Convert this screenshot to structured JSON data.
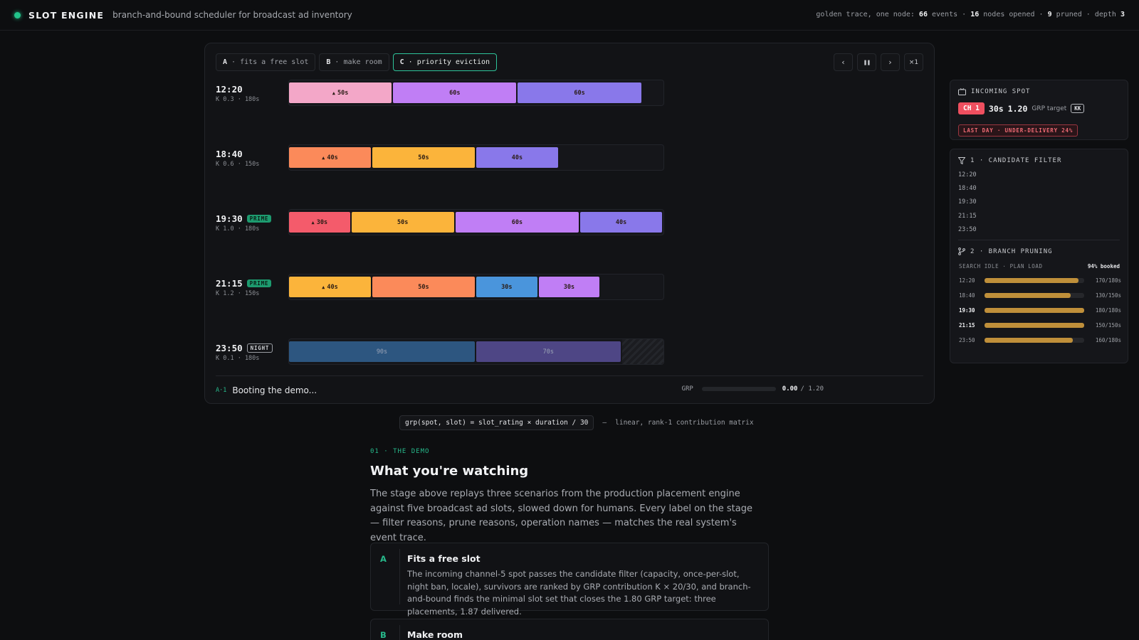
{
  "app": {
    "brand": "SLOT ENGINE",
    "tagline": "branch-and-bound scheduler for broadcast ad inventory",
    "stats": {
      "prefix": "golden trace, one node:",
      "events": "66",
      "events_label": "events",
      "nodes": "16",
      "nodes_label": "nodes opened",
      "pruned": "9",
      "pruned_label": "pruned",
      "depth_label": "depth",
      "depth": "3"
    }
  },
  "tabs": [
    {
      "key": "A",
      "label": "fits a free slot"
    },
    {
      "key": "B",
      "label": "make room"
    },
    {
      "key": "C",
      "label": "priority eviction"
    }
  ],
  "controls": {
    "prev": "‹",
    "pause": "❚❚",
    "next": "›",
    "speed": "×1"
  },
  "slots": [
    {
      "time": "12:20",
      "meta": "K 0.3 · 180s",
      "badge": "",
      "segments": [
        {
          "label": "50s",
          "locked": true,
          "color": "#f3a7c8",
          "start": 0,
          "dur": 50
        },
        {
          "label": "60s",
          "locked": false,
          "color": "#c07ef5",
          "start": 50,
          "dur": 60
        },
        {
          "label": "60s",
          "locked": false,
          "color": "#8978ea",
          "start": 110,
          "dur": 60
        }
      ],
      "capacity": 180,
      "hatch": false
    },
    {
      "time": "18:40",
      "meta": "K 0.6 · 150s",
      "badge": "",
      "segments": [
        {
          "label": "40s",
          "locked": true,
          "color": "#fb8a5a",
          "start": 0,
          "dur": 40
        },
        {
          "label": "50s",
          "locked": false,
          "color": "#fbb43b",
          "start": 40,
          "dur": 50
        },
        {
          "label": "40s",
          "locked": false,
          "color": "#8978ea",
          "start": 90,
          "dur": 40
        }
      ],
      "capacity": 150,
      "hatch": false
    },
    {
      "time": "19:30",
      "meta": "K 1.0 · 180s",
      "badge": "PRIME",
      "badge_type": "prime",
      "segments": [
        {
          "label": "30s",
          "locked": true,
          "color": "#f45b6b",
          "start": 0,
          "dur": 30
        },
        {
          "label": "50s",
          "locked": false,
          "color": "#fbb43b",
          "start": 30,
          "dur": 50
        },
        {
          "label": "60s",
          "locked": false,
          "color": "#c07ef5",
          "start": 80,
          "dur": 60
        },
        {
          "label": "40s",
          "locked": false,
          "color": "#8978ea",
          "start": 140,
          "dur": 40
        }
      ],
      "capacity": 180,
      "hatch": false
    },
    {
      "time": "21:15",
      "meta": "K 1.2 · 150s",
      "badge": "PRIME",
      "badge_type": "prime",
      "segments": [
        {
          "label": "40s",
          "locked": true,
          "color": "#fbb43b",
          "start": 0,
          "dur": 40
        },
        {
          "label": "50s",
          "locked": false,
          "color": "#fb8a5a",
          "start": 40,
          "dur": 50
        },
        {
          "label": "30s",
          "locked": false,
          "color": "#4a95dc",
          "start": 90,
          "dur": 30
        },
        {
          "label": "30s",
          "locked": false,
          "color": "#c07ef5",
          "start": 120,
          "dur": 30
        }
      ],
      "capacity": 150,
      "hatch": false
    },
    {
      "time": "23:50",
      "meta": "K 0.1 · 180s",
      "badge": "NIGHT",
      "badge_type": "night",
      "segments": [
        {
          "label": "90s",
          "locked": false,
          "color": "#2d5680",
          "start": 0,
          "dur": 90,
          "dim": true
        },
        {
          "label": "70s",
          "locked": false,
          "color": "#4e4685",
          "start": 90,
          "dur": 70,
          "dim": true
        }
      ],
      "capacity": 180,
      "hatch": true
    }
  ],
  "incoming": {
    "title": "INCOMING SPOT",
    "channel": "CH 1",
    "duration": "30s",
    "grp": "1.20",
    "grp_label": "GRP target",
    "locale": "KK",
    "warning": "LAST DAY · UNDER-DELIVERY 24%"
  },
  "filter": {
    "title": "1 · CANDIDATE FILTER",
    "items": [
      "12:20",
      "18:40",
      "19:30",
      "21:15",
      "23:50"
    ]
  },
  "pruning": {
    "title": "2 · BRANCH PRUNING",
    "sub_left": "SEARCH IDLE · PLAN LOAD",
    "sub_right": "94% booked",
    "rows": [
      {
        "time": "12:20",
        "used": 170,
        "cap": 180,
        "label": "170/180s",
        "bold": false
      },
      {
        "time": "18:40",
        "used": 130,
        "cap": 150,
        "label": "130/150s",
        "bold": false
      },
      {
        "time": "19:30",
        "used": 180,
        "cap": 180,
        "label": "180/180s",
        "bold": true
      },
      {
        "time": "21:15",
        "used": 150,
        "cap": 150,
        "label": "150/150s",
        "bold": true
      },
      {
        "time": "23:50",
        "used": 160,
        "cap": 180,
        "label": "160/180s",
        "bold": false
      }
    ]
  },
  "footer": {
    "step": "A·1",
    "status": "Booting the demo...",
    "grp_label": "GRP",
    "grp_value": "0.00",
    "grp_target": "/ 1.20",
    "grp_progress": 0
  },
  "formula": {
    "code": "grp(spot, slot) = slot_rating × duration / 30",
    "dash": "—",
    "note": "linear, rank-1 contribution matrix"
  },
  "doc": {
    "eyebrow": "01 · THE DEMO",
    "title": "What you're watching",
    "para": "The stage above replays three scenarios from the production placement engine against five broadcast ad slots, slowed down for humans. Every label on the stage — filter reasons, prune reasons, operation names — matches the real system's event trace.",
    "cards": [
      {
        "letter": "A",
        "title": "Fits a free slot",
        "body": "The incoming channel-5 spot passes the candidate filter (capacity, once-per-slot, night ban, locale), survivors are ranked by GRP contribution K × 20/30, and branch-and-bound finds the minimal slot set that closes the 1.80 GRP target: three placements, 1.87 delivered."
      },
      {
        "letter": "B",
        "title": "Make room",
        "body": ""
      }
    ]
  }
}
